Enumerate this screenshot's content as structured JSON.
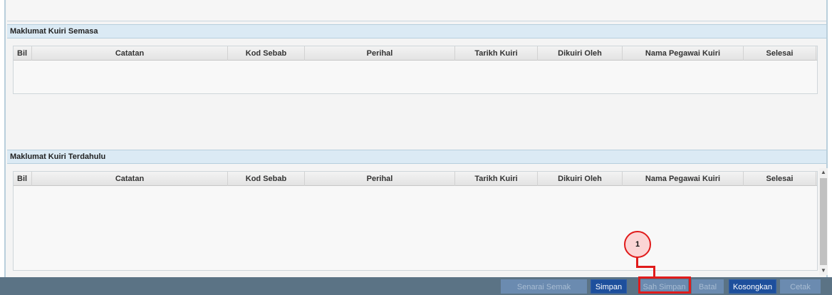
{
  "current_section": {
    "title": "Maklumat Kuiri Semasa",
    "columns": [
      "Bil",
      "Catatan",
      "Kod Sebab",
      "Perihal",
      "Tarikh Kuiri",
      "Dikuiri Oleh",
      "Nama Pegawai Kuiri",
      "Selesai"
    ],
    "rows": []
  },
  "previous_section": {
    "title": "Maklumat Kuiri Terdahulu",
    "columns": [
      "Bil",
      "Catatan",
      "Kod Sebab",
      "Perihal",
      "Tarikh Kuiri",
      "Dikuiri Oleh",
      "Nama Pegawai Kuiri",
      "Selesai"
    ],
    "rows": []
  },
  "toolbar": {
    "senarai_semak": "Senarai Semak",
    "simpan": "Simpan",
    "sah_simpan": "Sah Simpan",
    "batal": "Batal",
    "kosongkan": "Kosongkan",
    "cetak": "Cetak"
  },
  "annotation": {
    "step_number": "1",
    "color": "#e01b1b"
  }
}
